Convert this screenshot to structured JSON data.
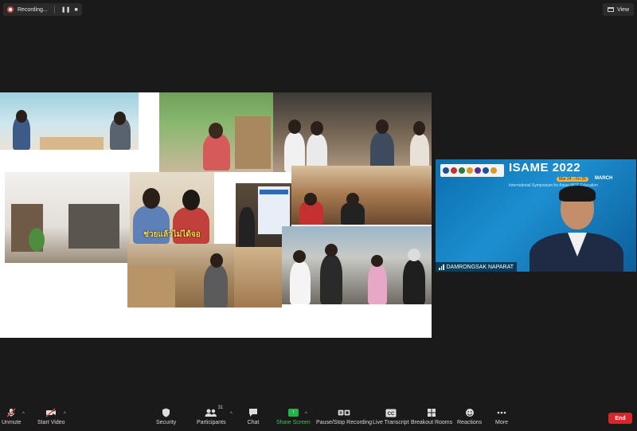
{
  "recording": {
    "status": "Recording..."
  },
  "view_label": "View",
  "shared_screen": {
    "photo_caption": "ช่วยแล้วไม่ได้จอ"
  },
  "speaker": {
    "name": "DAMRONGSAK NAPARAT",
    "event_title": "ISAME 2022",
    "event_subtitle": "International Symposium for Asian MOT Education",
    "event_month": "MARCH",
    "event_dates": "Mar 24 – Fri 25"
  },
  "toolbar": {
    "unmute": "Unmute",
    "start_video": "Start Video",
    "security": "Security",
    "participants": "Participants",
    "participants_count": "31",
    "chat": "Chat",
    "share_screen": "Share Screen",
    "pause_stop_recording": "Pause/Stop Recording",
    "live_transcript": "Live Transcript",
    "breakout_rooms": "Breakout Rooms",
    "reactions": "Reactions",
    "more": "More",
    "end": "End"
  },
  "colors": {
    "background": "#1a1a1a",
    "share_green": "#24b24b",
    "end_red": "#d9262d",
    "muted_red": "#e14545"
  }
}
